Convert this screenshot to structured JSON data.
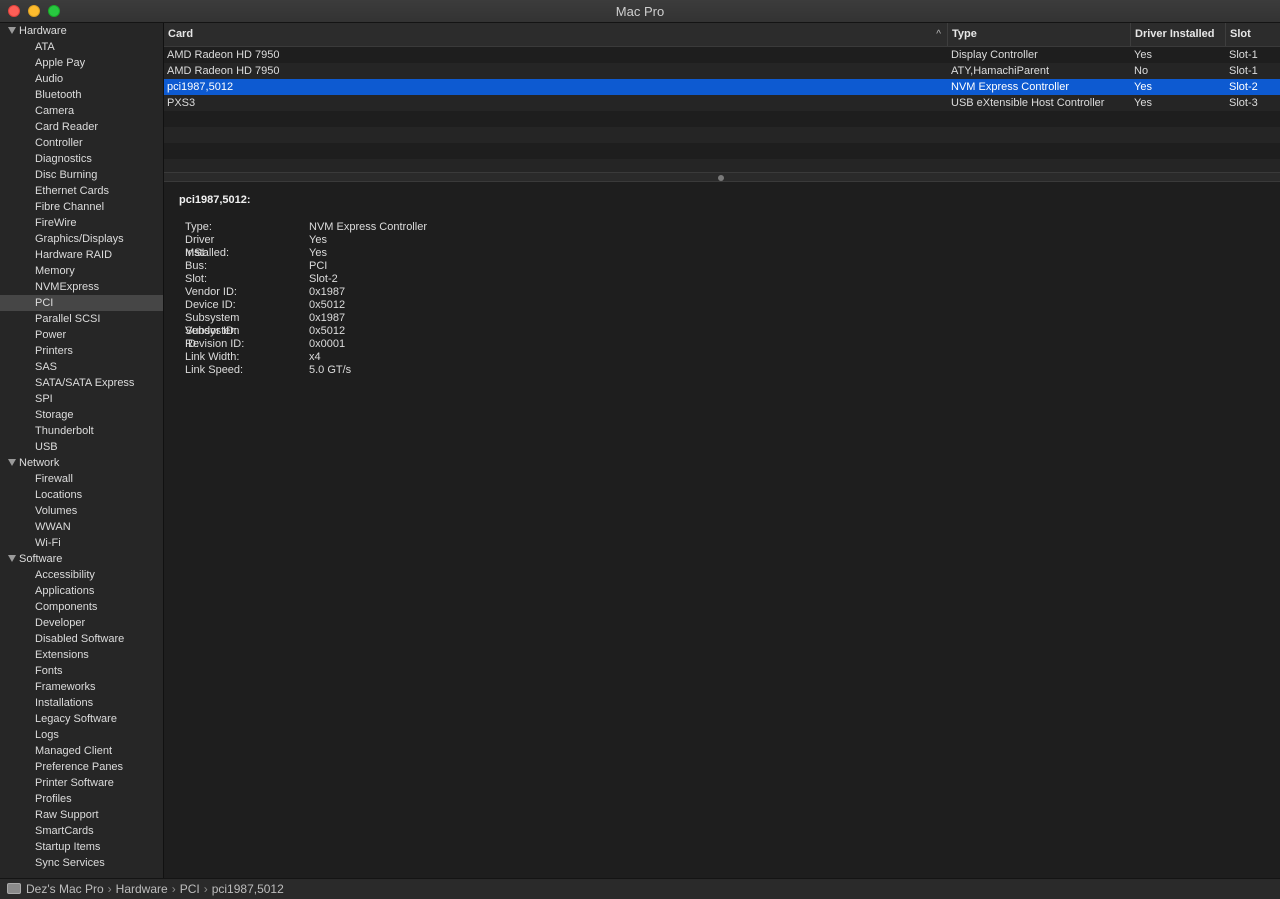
{
  "window": {
    "title": "Mac Pro"
  },
  "sidebar": {
    "groups": [
      {
        "label": "Hardware",
        "items": [
          "ATA",
          "Apple Pay",
          "Audio",
          "Bluetooth",
          "Camera",
          "Card Reader",
          "Controller",
          "Diagnostics",
          "Disc Burning",
          "Ethernet Cards",
          "Fibre Channel",
          "FireWire",
          "Graphics/Displays",
          "Hardware RAID",
          "Memory",
          "NVMExpress",
          "PCI",
          "Parallel SCSI",
          "Power",
          "Printers",
          "SAS",
          "SATA/SATA Express",
          "SPI",
          "Storage",
          "Thunderbolt",
          "USB"
        ]
      },
      {
        "label": "Network",
        "items": [
          "Firewall",
          "Locations",
          "Volumes",
          "WWAN",
          "Wi-Fi"
        ]
      },
      {
        "label": "Software",
        "items": [
          "Accessibility",
          "Applications",
          "Components",
          "Developer",
          "Disabled Software",
          "Extensions",
          "Fonts",
          "Frameworks",
          "Installations",
          "Legacy Software",
          "Logs",
          "Managed Client",
          "Preference Panes",
          "Printer Software",
          "Profiles",
          "Raw Support",
          "SmartCards",
          "Startup Items",
          "Sync Services"
        ]
      }
    ],
    "selected": "PCI"
  },
  "table": {
    "columns": [
      "Card",
      "Type",
      "Driver Installed",
      "Slot"
    ],
    "sort_indicator": "^",
    "rows": [
      {
        "card": "AMD Radeon HD 7950",
        "type": "Display Controller",
        "driver": "Yes",
        "slot": "Slot-1"
      },
      {
        "card": "AMD Radeon HD 7950",
        "type": "ATY,HamachiParent",
        "driver": "No",
        "slot": "Slot-1"
      },
      {
        "card": "pci1987,5012",
        "type": "NVM Express Controller",
        "driver": "Yes",
        "slot": "Slot-2"
      },
      {
        "card": "PXS3",
        "type": "USB eXtensible Host Controller",
        "driver": "Yes",
        "slot": "Slot-3"
      }
    ],
    "selected_row": 2
  },
  "detail": {
    "title": "pci1987,5012:",
    "fields": [
      {
        "key": "Type:",
        "value": "NVM Express Controller"
      },
      {
        "key": "Driver Installed:",
        "value": "Yes"
      },
      {
        "key": "MSI:",
        "value": "Yes"
      },
      {
        "key": "Bus:",
        "value": "PCI"
      },
      {
        "key": "Slot:",
        "value": "Slot-2"
      },
      {
        "key": "Vendor ID:",
        "value": "0x1987"
      },
      {
        "key": "Device ID:",
        "value": "0x5012"
      },
      {
        "key": "Subsystem Vendor ID:",
        "value": "0x1987"
      },
      {
        "key": "Subsystem ID:",
        "value": "0x5012"
      },
      {
        "key": "Revision ID:",
        "value": "0x0001"
      },
      {
        "key": "Link Width:",
        "value": "x4"
      },
      {
        "key": "Link Speed:",
        "value": "5.0 GT/s"
      }
    ]
  },
  "statusbar": {
    "icon": "computer-icon",
    "separator": "›",
    "path": [
      "Dez's Mac Pro",
      "Hardware",
      "PCI",
      "pci1987,5012"
    ]
  },
  "colors": {
    "selection": "#0d5ad1",
    "sidebar_selected": "#464646"
  }
}
